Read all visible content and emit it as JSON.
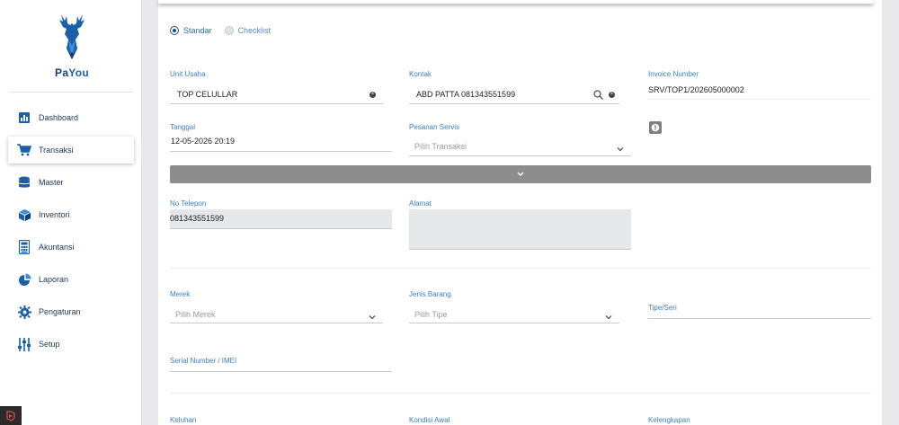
{
  "app": {
    "logo_text_a": "Pa",
    "logo_text_b": "You"
  },
  "sidebar": {
    "items": [
      {
        "label": "Dashboard",
        "icon": "dashboard-icon",
        "active": false
      },
      {
        "label": "Transaksi",
        "icon": "cart-icon",
        "active": true
      },
      {
        "label": "Master",
        "icon": "database-icon",
        "active": false
      },
      {
        "label": "Inventori",
        "icon": "box-icon",
        "active": false
      },
      {
        "label": "Akuntansi",
        "icon": "calculator-icon",
        "active": false
      },
      {
        "label": "Laporan",
        "icon": "pie-chart-icon",
        "active": false
      },
      {
        "label": "Pengaturan",
        "icon": "gear-icon",
        "active": false
      },
      {
        "label": "Setup",
        "icon": "sliders-icon",
        "active": false
      }
    ]
  },
  "form": {
    "mode_options": [
      {
        "label": "Standar",
        "selected": true
      },
      {
        "label": "Checklist",
        "selected": false
      }
    ],
    "unit_usaha": {
      "label": "Unit Usaha",
      "value": "TOP CELULLAR"
    },
    "kontak": {
      "label": "Kontak",
      "value": "ABD PATTA 081343551599"
    },
    "invoice": {
      "label": "Invoice Number",
      "value": "SRV/TOP1/202605000002"
    },
    "tanggal": {
      "label": "Tanggal",
      "value": "12-05-2026 20:19"
    },
    "pesanan_servis": {
      "label": "Pesanan Servis",
      "placeholder": "Pilih Transaksi"
    },
    "no_telepon": {
      "label": "No Telepon",
      "value": "081343551599"
    },
    "alamat": {
      "label": "Alamat",
      "value": ""
    },
    "merek": {
      "label": "Merek",
      "placeholder": "Pilih Merek"
    },
    "jenis_barang": {
      "label": "Jenis Barang",
      "placeholder": "Pilih Tipe"
    },
    "tipe_seri": {
      "label": "Tipe/Seri",
      "value": ""
    },
    "serial_number": {
      "label": "Serial Number / IMEI",
      "value": ""
    },
    "keluhan": {
      "label": "Keluhan"
    },
    "kondisi_awal": {
      "label": "Kondisi Awal"
    },
    "kelengkapan": {
      "label": "Kelengkapan"
    }
  },
  "colors": {
    "accent": "#1a4f8a",
    "label": "#3b7fbf",
    "collapse_bar": "#8d8d8d"
  }
}
